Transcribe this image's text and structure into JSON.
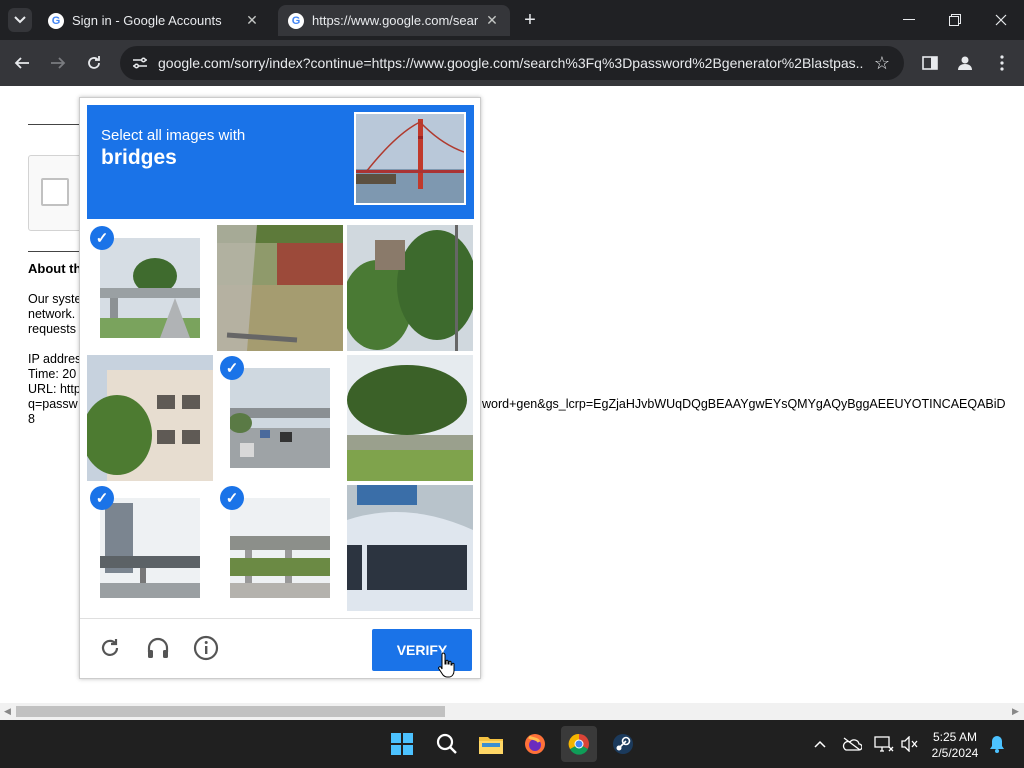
{
  "browser": {
    "tabs": [
      {
        "title": "Sign in - Google Accounts"
      },
      {
        "title": "https://www.google.com/search"
      }
    ],
    "url": "google.com/sorry/index?continue=https://www.google.com/search%3Fq%3Dpassword%2Bgenerator%2Blastpas..."
  },
  "page": {
    "about_heading": "About th",
    "body_lines": [
      "Our syste",
      "network.",
      "requests"
    ],
    "info_lines": [
      "IP addres",
      "Time: 20",
      "URL: http",
      "q=passw",
      "8"
    ],
    "url_tail": "word+gen&gs_lcrp=EgZjaHJvbWUqDQgBEAAYgwEYsQMYgAQyBggAEEUYOTINCAEQABiD"
  },
  "captcha": {
    "instruction": "Select all images with",
    "target": "bridges",
    "tiles_selected": [
      true,
      false,
      false,
      false,
      true,
      false,
      true,
      true,
      false
    ],
    "verify_label": "VERIFY"
  },
  "taskbar": {
    "time": "5:25 AM",
    "date": "2/5/2024"
  },
  "colors": {
    "accent": "#1a73e8",
    "chrome_dark": "#202124",
    "toolbar": "#35363a"
  }
}
